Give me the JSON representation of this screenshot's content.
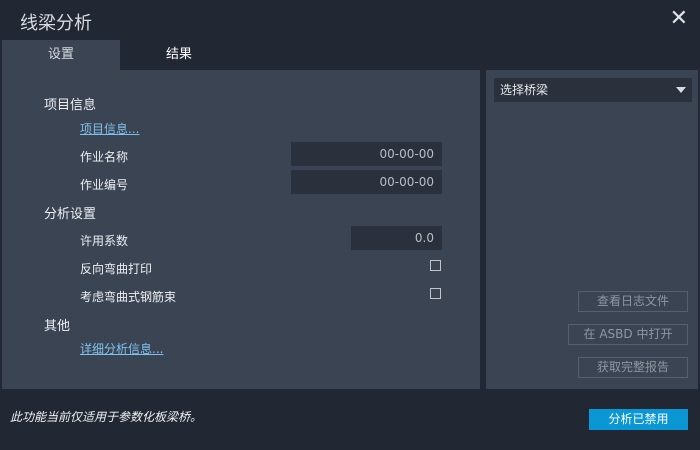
{
  "window": {
    "title": "线梁分析",
    "close": "✕"
  },
  "tabs": [
    {
      "label": "设置"
    },
    {
      "label": "结果"
    }
  ],
  "settings": {
    "project_header": "项目信息",
    "project_link": "项目信息...",
    "job_name_label": "作业名称",
    "job_name_value": "00-00-00",
    "job_number_label": "作业编号",
    "job_number_value": "00-00-00",
    "analysis_header": "分析设置",
    "allowance_label": "许用系数",
    "allowance_value": "0.0",
    "reverse_bending_label": "反向弯曲打印",
    "reverse_bending_checked": false,
    "curved_tendon_label": "考虑弯曲式钢筋束",
    "curved_tendon_checked": false,
    "other_header": "其他",
    "details_link": "详细分析信息..."
  },
  "right": {
    "select_bridge": "选择桥梁",
    "view_log": "查看日志文件",
    "open_asbd": "在 ASBD 中打开",
    "get_report": "获取完整报告"
  },
  "footer": {
    "note": "此功能当前仅适用于参数化板梁桥。",
    "analyze": "分析已禁用"
  }
}
